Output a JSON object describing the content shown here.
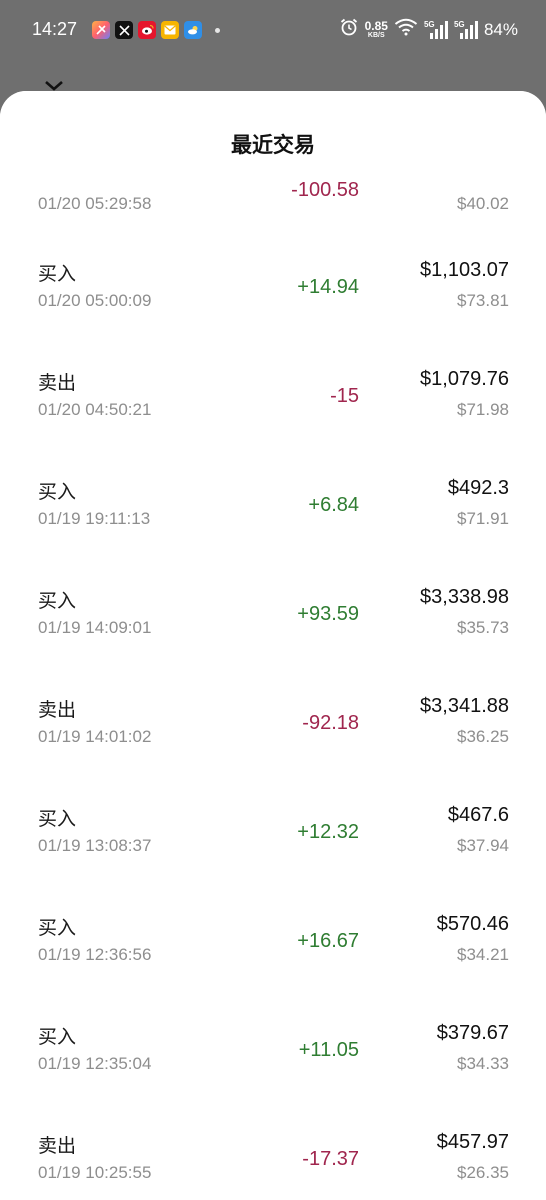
{
  "status_bar": {
    "time": "14:27",
    "net_speed_value": "0.85",
    "net_speed_unit": "KB/S",
    "signal_1": "5G",
    "signal_2": "5G",
    "battery": "84%",
    "notification_icons": [
      "app-store-icon",
      "x-icon",
      "weibo-icon",
      "mail-icon",
      "weather-icon"
    ]
  },
  "sheet": {
    "title": "最近交易"
  },
  "colors": {
    "positive": "#2f7d32",
    "negative": "#a0264e"
  },
  "transactions": [
    {
      "type": "",
      "time": "01/20 05:29:58",
      "change": "-100.58",
      "direction": "neg",
      "amount": "",
      "price": "$40.02"
    },
    {
      "type": "买入",
      "time": "01/20 05:00:09",
      "change": "+14.94",
      "direction": "pos",
      "amount": "$1,103.07",
      "price": "$73.81"
    },
    {
      "type": "卖出",
      "time": "01/20 04:50:21",
      "change": "-15",
      "direction": "neg",
      "amount": "$1,079.76",
      "price": "$71.98"
    },
    {
      "type": "买入",
      "time": "01/19 19:11:13",
      "change": "+6.84",
      "direction": "pos",
      "amount": "$492.3",
      "price": "$71.91"
    },
    {
      "type": "买入",
      "time": "01/19 14:09:01",
      "change": "+93.59",
      "direction": "pos",
      "amount": "$3,338.98",
      "price": "$35.73"
    },
    {
      "type": "卖出",
      "time": "01/19 14:01:02",
      "change": "-92.18",
      "direction": "neg",
      "amount": "$3,341.88",
      "price": "$36.25"
    },
    {
      "type": "买入",
      "time": "01/19 13:08:37",
      "change": "+12.32",
      "direction": "pos",
      "amount": "$467.6",
      "price": "$37.94"
    },
    {
      "type": "买入",
      "time": "01/19 12:36:56",
      "change": "+16.67",
      "direction": "pos",
      "amount": "$570.46",
      "price": "$34.21"
    },
    {
      "type": "买入",
      "time": "01/19 12:35:04",
      "change": "+11.05",
      "direction": "pos",
      "amount": "$379.67",
      "price": "$34.33"
    },
    {
      "type": "卖出",
      "time": "01/19 10:25:55",
      "change": "-17.37",
      "direction": "neg",
      "amount": "$457.97",
      "price": "$26.35"
    }
  ]
}
